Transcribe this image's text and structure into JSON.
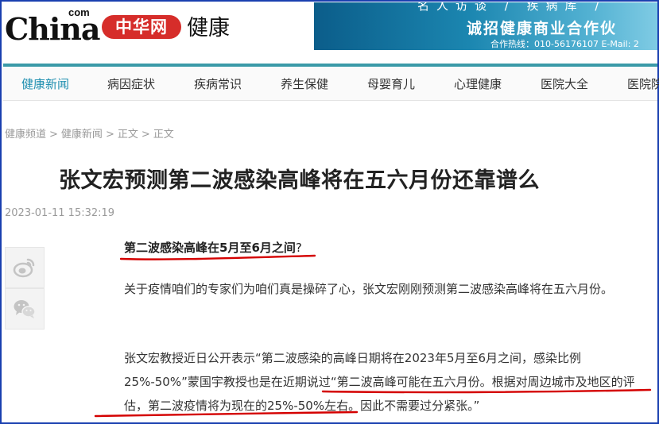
{
  "header": {
    "logo_china": "China",
    "logo_com": "com",
    "logo_cn": "中华网",
    "channel": "健康",
    "banner": {
      "top_text": "名人访谈 / 疾病库 /",
      "main_text": "诚招健康商业合作伙",
      "contact": "合作热线：010-56176107    E-Mail: 2"
    }
  },
  "nav": {
    "items": [
      {
        "label": "健康新闻",
        "active": true
      },
      {
        "label": "病因症状"
      },
      {
        "label": "疾病常识"
      },
      {
        "label": "养生保健"
      },
      {
        "label": "母婴育儿"
      },
      {
        "label": "心理健康"
      },
      {
        "label": "医院大全"
      },
      {
        "label": "医院院"
      }
    ]
  },
  "breadcrumb": [
    "健康频道",
    "健康新闻",
    "正文",
    "正文"
  ],
  "breadcrumb_sep": ">",
  "article": {
    "title": "张文宏预测第二波感染高峰将在五六月份还靠谱么",
    "date": "2023-01-11 15:32:19",
    "subhead": "第二波感染高峰在5月至6月之间",
    "subhead_mark": "?",
    "para1": "关于疫情咱们的专家们为咱们真是操碎了心，张文宏刚刚预测第二波感染高峰将在五六月份。",
    "para2": "张文宏教授近日公开表示“第二波感染的高峰日期将在2023年5月至6月之间，感染比例25%-50%”蒙国宇教授也是在近期说过“第二波高峰可能在五六月份。根据对周边城市及地区的评估，第二波疫情将为现在的25%-50%左右。因此不需要过分紧张。”"
  },
  "share": [
    {
      "icon": "weibo-icon"
    },
    {
      "icon": "wechat-icon"
    }
  ],
  "colors": {
    "frame": "#1a3fb0",
    "nav_active": "#1f8fb0",
    "brand_red": "#d62d2a",
    "annotation_red": "#d40000"
  }
}
